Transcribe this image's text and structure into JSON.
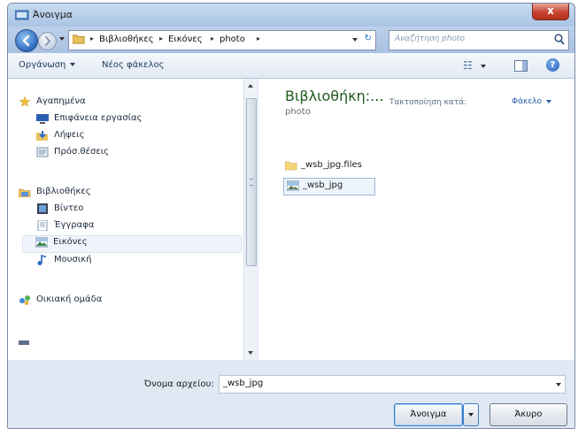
{
  "window": {
    "title": "Άνοιγμα",
    "close_label": "x"
  },
  "address": {
    "segments": [
      "Βιβλιοθήκες",
      "Εικόνες",
      "photo"
    ],
    "separator": "▸",
    "search_placeholder": "Αναζήτηση photo"
  },
  "toolbar": {
    "organize": "Οργάνωση",
    "new_folder": "Νέος φάκελος",
    "help": "?"
  },
  "sidebar": {
    "favorites": {
      "label": "Αγαπημένα",
      "items": [
        {
          "label": "Επιφάνεια εργασίας",
          "icon": "desktop-icon"
        },
        {
          "label": "Λήψεις",
          "icon": "downloads-icon"
        },
        {
          "label": "Πρόσ.θέσεις",
          "icon": "recent-places-icon"
        }
      ]
    },
    "libraries": {
      "label": "Βιβλιοθήκες",
      "items": [
        {
          "label": "Βίντεο",
          "icon": "video-library-icon"
        },
        {
          "label": "Έγγραφα",
          "icon": "documents-library-icon"
        },
        {
          "label": "Εικόνες",
          "icon": "pictures-library-icon",
          "selected": true
        },
        {
          "label": "Μουσική",
          "icon": "music-library-icon"
        }
      ]
    },
    "homegroup": {
      "label": "Οικιακή ομάδα"
    }
  },
  "content": {
    "library_title": "Βιβλιοθήκη:...",
    "library_subtitle": "photo",
    "arrange_label": "Τακτοποίηση κατά:",
    "arrange_value": "Φάκελο",
    "files": [
      {
        "name": "_wsb_jpg.files",
        "type": "folder"
      },
      {
        "name": "_wsb_jpg",
        "type": "image",
        "selected": true
      }
    ]
  },
  "footer": {
    "filename_label": "Όνομα αρχείου:",
    "filename_value": "_wsb_jpg",
    "open_label": "Άνοιγμα",
    "cancel_label": "Άκυρο"
  },
  "colors": {
    "title_bar": "#b4cdea",
    "close_button": "#c7432f",
    "library_title": "#1e5a1e",
    "accent_link": "#2a5aa3"
  }
}
